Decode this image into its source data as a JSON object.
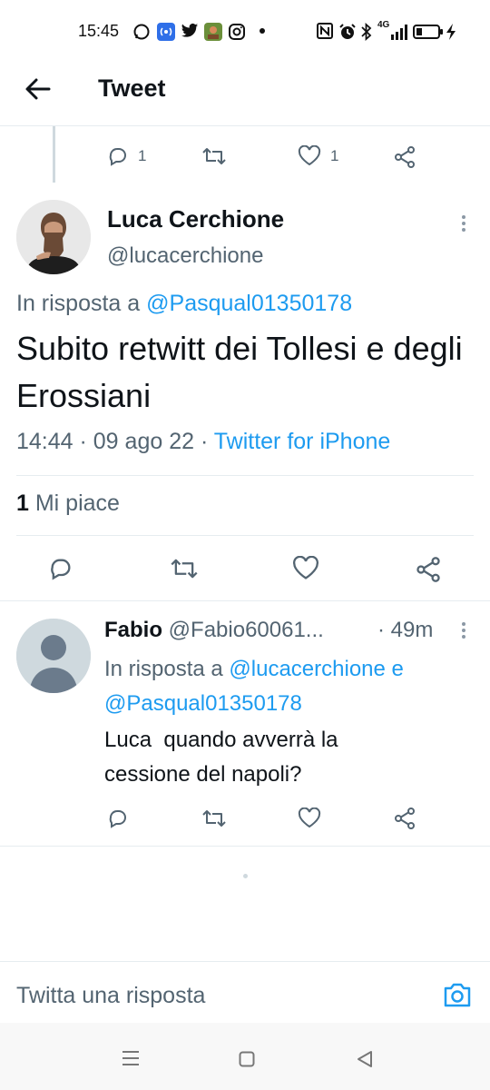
{
  "status_bar": {
    "time": "15:45",
    "network": "4G",
    "icons": [
      "whatsapp-icon",
      "hotspot-icon",
      "twitter-icon",
      "app-icon",
      "instagram-icon",
      "dot-icon",
      "nfc-icon",
      "alarm-icon",
      "bluetooth-icon",
      "signal-icon",
      "battery-icon",
      "charging-icon"
    ]
  },
  "header": {
    "title": "Tweet"
  },
  "parent_actions": {
    "reply_count": "1",
    "like_count": "1"
  },
  "main_tweet": {
    "name": "Luca Cerchione",
    "handle": "@lucacerchione",
    "reply_prefix": "In risposta a ",
    "reply_to": "@Pasqual01350178",
    "text": "Subito retwitt dei Tollesi e degli Erossiani",
    "time": "14:44",
    "date": "09 ago 22",
    "source": "Twitter for iPhone",
    "likes_count": "1",
    "likes_label": "Mi piace"
  },
  "reply": {
    "name": "Fabio",
    "handle": "@Fabio60061...",
    "time": "· 49m",
    "reply_prefix": "In risposta a ",
    "reply_to_1": "@lucacerchione",
    "reply_joiner": " e",
    "reply_to_2": "@Pasqual01350178",
    "text_line1": "Luca  quando avverrà la",
    "text_line2": "cessione del napoli?"
  },
  "compose": {
    "placeholder": "Twitta una risposta"
  },
  "colors": {
    "accent": "#1d9bf0",
    "muted": "#536471",
    "text": "#0f1419",
    "border": "#e6ecf0"
  }
}
